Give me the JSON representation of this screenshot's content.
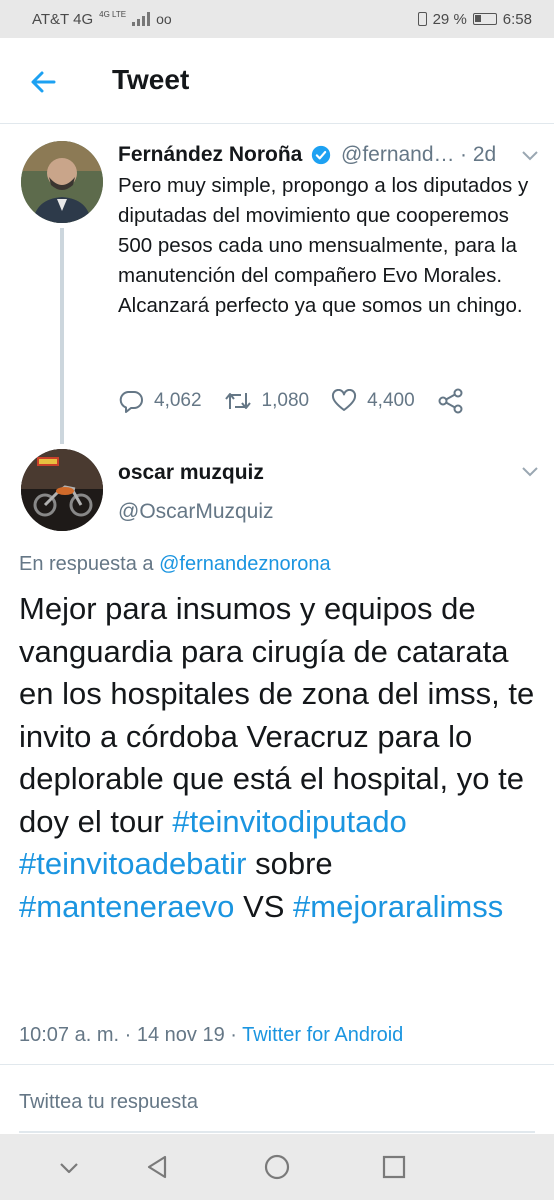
{
  "status_bar": {
    "carrier": "AT&T 4G",
    "network_badge": "4G LTE",
    "voicemail_icon": "oo",
    "battery_percent": "29 %",
    "time": "6:58"
  },
  "header": {
    "title": "Tweet"
  },
  "parent_tweet": {
    "author_name": "Fernández Noroña",
    "handle": "@fernand…",
    "age": "2d",
    "text": "Pero muy simple, propongo a los diputados y diputadas del movimiento que cooperemos 500 pesos cada uno mensualmente, para la manutención del compañero Evo Morales. Alcanzará perfecto ya que somos un chingo.",
    "replies": "4,062",
    "retweets": "1,080",
    "likes": "4,400"
  },
  "main_tweet": {
    "author_name": "oscar muzquiz",
    "handle": "@OscarMuzquiz",
    "reply_prefix": "En respuesta a",
    "reply_mention": "@fernandeznorona",
    "text_plain": "Mejor para insumos y equipos de vanguardia para cirugía de catarata en los hospitales de zona del imss, te invito a córdoba Veracruz para lo deplorable que está el hospital, yo te doy el tour",
    "hashtag1": "#teinvitodiputado",
    "hashtag2": "#teinvitoadebatir",
    "word_sobre": "sobre",
    "hashtag3": "#manteneraevo",
    "word_vs": "VS",
    "hashtag4": "#mejoraralimss",
    "time": "10:07 a. m.",
    "separator1": " · ",
    "date": "14 nov 19",
    "separator2": " · ",
    "source": "Twitter for Android"
  },
  "reply_box": {
    "placeholder": "Twittea tu respuesta"
  },
  "colors": {
    "link": "#1b95e0",
    "muted": "#657786",
    "text": "#14171a"
  },
  "icons": [
    "back-arrow-icon",
    "verified-icon",
    "chevron-down-icon",
    "reply-icon",
    "retweet-icon",
    "like-icon",
    "share-icon",
    "nav-back-icon",
    "nav-home-icon",
    "nav-recents-icon",
    "nav-down-icon"
  ]
}
